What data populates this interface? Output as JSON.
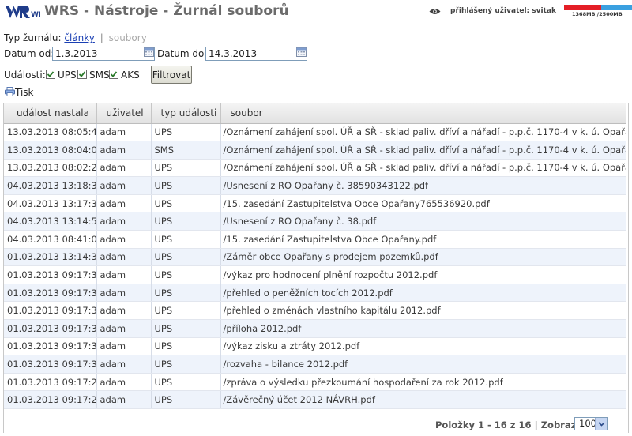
{
  "header": {
    "logo_text": "WRS",
    "title": "WRS - Nástroje - Žurnál souborů",
    "user_label": "přihlášený uživatel: svitak",
    "quota_text": "1368MB /2500MB",
    "quota_used_fraction": 0.55
  },
  "filter": {
    "journal_type_label": "Typ žurnálu:",
    "journal_type_active": "články",
    "journal_type_separator": "|",
    "journal_type_inactive": "soubory",
    "date_from_label": "Datum od:",
    "date_from_value": "1.3.2013",
    "date_to_label": "Datum do:",
    "date_to_value": "14.3.2013",
    "events_label": "Události:",
    "checkboxes": [
      {
        "label": "UPS",
        "checked": true
      },
      {
        "label": "SMS",
        "checked": true
      },
      {
        "label": "AKS",
        "checked": true
      }
    ],
    "filter_button": "Filtrovat"
  },
  "print_label": "Tisk",
  "table": {
    "columns": [
      "událost nastala",
      "uživatel",
      "typ události",
      "soubor"
    ],
    "rows": [
      [
        "13.03.2013 08:05:40",
        "adam",
        "UPS",
        "/Oznámení zahájení spol. ÚŘ a SŘ - sklad paliv. dříví a nářadí - p.p.č. 1170-4 v k. ú. Opařany.pdf"
      ],
      [
        "13.03.2013 08:04:06",
        "adam",
        "SMS",
        "/Oznámení zahájení spol. ÚŘ a SŘ - sklad paliv. dříví a nářadí - p.p.č. 1170-4 v k. ú. Opařany.pdf"
      ],
      [
        "13.03.2013 08:02:20",
        "adam",
        "UPS",
        "/Oznámení zahájení spol. ÚŘ a SŘ - sklad paliv. dříví a nářadí - p.p.č. 1170-4 v k. ú. Opařany.pdf"
      ],
      [
        "04.03.2013 13:18:37",
        "adam",
        "UPS",
        "/Usnesení z RO Opařany č. 38590343122.pdf"
      ],
      [
        "04.03.2013 13:17:37",
        "adam",
        "UPS",
        "/15. zasedání Zastupitelstva Obce Opařany765536920.pdf"
      ],
      [
        "04.03.2013 13:14:50",
        "adam",
        "UPS",
        "/Usnesení z RO Opařany č. 38.pdf"
      ],
      [
        "04.03.2013 08:41:03",
        "adam",
        "UPS",
        "/15. zasedání Zastupitelstva Obce Opařany.pdf"
      ],
      [
        "01.03.2013 13:14:38",
        "adam",
        "UPS",
        "/Záměr obce Opařany s prodejem pozemků.pdf"
      ],
      [
        "01.03.2013 09:17:30",
        "adam",
        "UPS",
        "/výkaz pro hodnocení plnění rozpočtu 2012.pdf"
      ],
      [
        "01.03.2013 09:17:30",
        "adam",
        "UPS",
        "/přehled o peněžních tocích 2012.pdf"
      ],
      [
        "01.03.2013 09:17:30",
        "adam",
        "UPS",
        "/přehled o změnách vlastního kapitálu 2012.pdf"
      ],
      [
        "01.03.2013 09:17:30",
        "adam",
        "UPS",
        "/příloha 2012.pdf"
      ],
      [
        "01.03.2013 09:17:30",
        "adam",
        "UPS",
        "/výkaz zisku a ztráty 2012.pdf"
      ],
      [
        "01.03.2013 09:17:30",
        "adam",
        "UPS",
        "/rozvaha - bilance 2012.pdf"
      ],
      [
        "01.03.2013 09:17:29",
        "adam",
        "UPS",
        "/zpráva o výsledku přezkoumání hospodaření za rok 2012.pdf"
      ],
      [
        "01.03.2013 09:17:29",
        "adam",
        "UPS",
        "/Závěrečný účet 2012 NÁVRH.pdf"
      ]
    ]
  },
  "pager": {
    "summary": "Položky 1 - 16 z 16 | Zobrazit:",
    "page_size": "100"
  },
  "colors": {
    "link": "#1a3fb3",
    "quota_used": "#e41e26",
    "quota_free": "#3aa0e0",
    "row_alt": "#eef3fb"
  }
}
